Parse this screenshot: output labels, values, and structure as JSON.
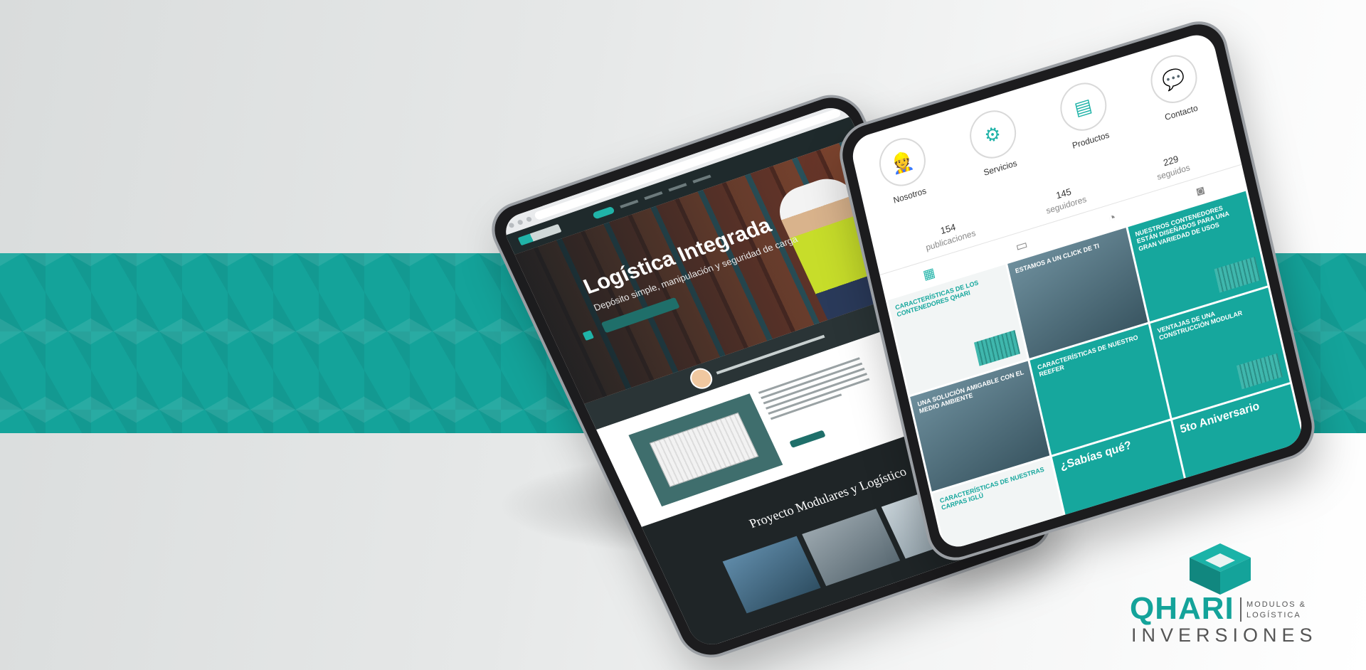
{
  "website": {
    "hero_title": "Logística Integrada",
    "hero_subtitle": "Depósito simple, manipulación y seguridad de carga",
    "projects_title": "Proyecto Modulares y Logístico"
  },
  "instagram": {
    "highlights": [
      {
        "label": "Nosotros",
        "icon": "worker-icon",
        "glyph": "👷"
      },
      {
        "label": "Servicios",
        "icon": "gear-hand-icon",
        "glyph": "⚙"
      },
      {
        "label": "Productos",
        "icon": "container-icon",
        "glyph": "▤"
      },
      {
        "label": "Contacto",
        "icon": "chat-icon",
        "glyph": "💬"
      }
    ],
    "stats": [
      {
        "value": "154",
        "label": "publicaciones"
      },
      {
        "value": "145",
        "label": "seguidores"
      },
      {
        "value": "229",
        "label": "seguidos"
      }
    ],
    "posts": [
      {
        "text": "Características de los contenedores Qhari",
        "style": "white"
      },
      {
        "text": "Estamos a un click de ti",
        "style": "photo"
      },
      {
        "text": "Nuestros contenedores están diseñados para una gran variedad de usos",
        "style": "teal"
      },
      {
        "text": "Una solución amigable con el medio ambiente",
        "style": "photo"
      },
      {
        "text": "Características de nuestro reefer",
        "style": "teal"
      },
      {
        "text": "Ventajas de una construcción modular",
        "style": "teal"
      },
      {
        "text": "Características de nuestras carpas iglú",
        "style": "white"
      },
      {
        "text": "¿Sabías qué?",
        "style": "teal"
      },
      {
        "text": "5to Aniversario",
        "style": "teal"
      }
    ]
  },
  "brand": {
    "name": "QHARI",
    "tagline_line1": "MODULOS &",
    "tagline_line2": "LOGÍSTICA",
    "subtitle": "INVERSIONES",
    "accent_color": "#14a39a"
  }
}
